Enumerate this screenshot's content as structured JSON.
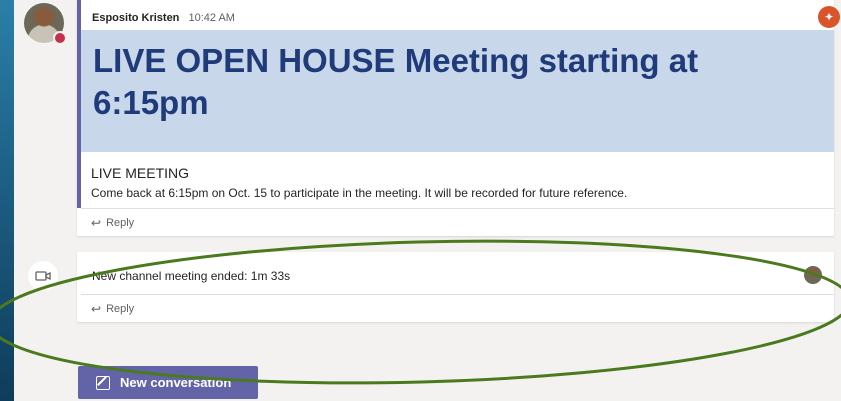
{
  "post": {
    "author": "Esposito Kristen",
    "time": "10:42 AM",
    "headline": "LIVE OPEN HOUSE Meeting starting at 6:15pm",
    "section_title": "LIVE MEETING",
    "body": "Come back at 6:15pm on Oct. 15 to participate in the meeting.  It will be recorded for future reference.",
    "reply_label": "Reply"
  },
  "meeting_post": {
    "text": "New channel meeting ended: 1m 33s",
    "reply_label": "Reply"
  },
  "compose": {
    "new_conversation_label": "New conversation"
  },
  "colors": {
    "accent": "#6264a7",
    "banner": "#c8d7ea",
    "headline": "#1f3b79",
    "annotation": "#4b7a1e",
    "presence_busy": "#c4314b"
  },
  "icons": {
    "reply": "reply-arrow-icon",
    "meeting": "video-camera-icon",
    "compose": "pencil-icon"
  }
}
